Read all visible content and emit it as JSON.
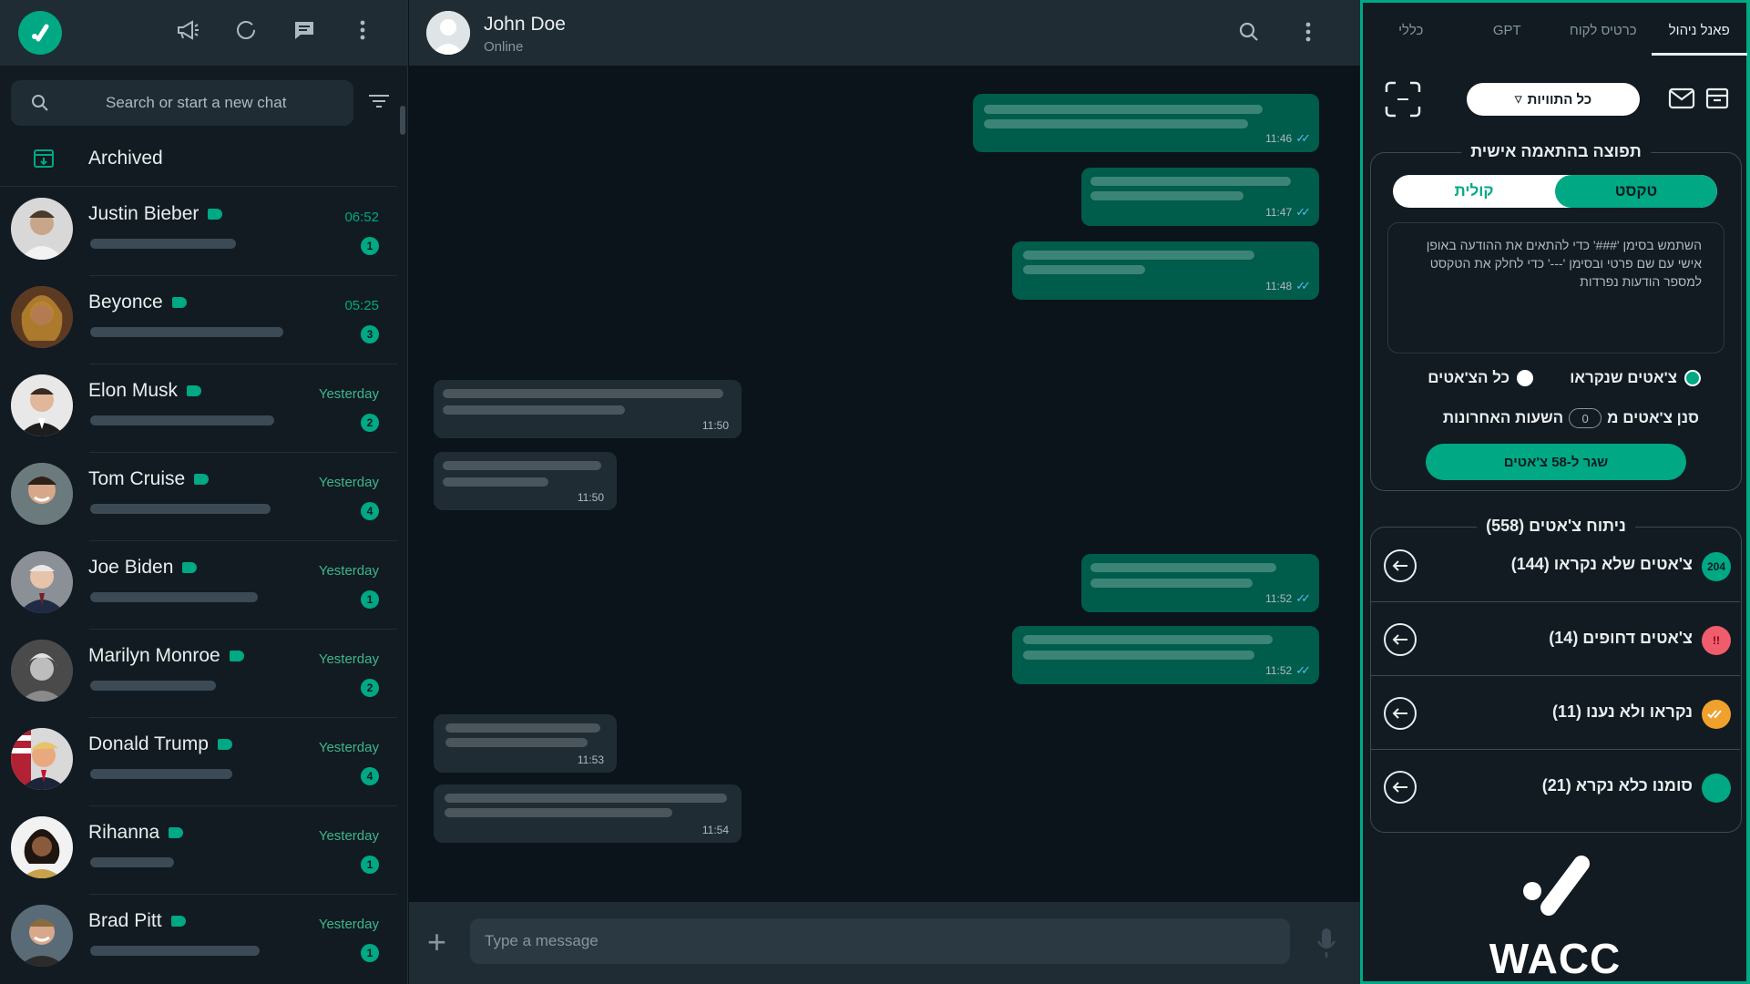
{
  "colors": {
    "accent": "#00a884",
    "panel_bg": "#111b21",
    "bubble_out": "#005c4b",
    "bubble_in": "#202c33",
    "red": "#f15c6d",
    "orange": "#f0a02c"
  },
  "sidebar": {
    "search_placeholder": "Search or start a new chat",
    "archived_label": "Archived",
    "header_icons": [
      "megaphone-icon",
      "status-ring-icon",
      "chat-bubble-icon",
      "menu-dots-icon"
    ],
    "chats": [
      {
        "name": "Justin Bieber",
        "time": "06:52",
        "unread": "1"
      },
      {
        "name": "Beyonce",
        "time": "05:25",
        "unread": "3"
      },
      {
        "name": "Elon Musk",
        "time": "Yesterday",
        "unread": "2"
      },
      {
        "name": "Tom Cruise",
        "time": "Yesterday",
        "unread": "4"
      },
      {
        "name": "Joe Biden",
        "time": "Yesterday",
        "unread": "1"
      },
      {
        "name": "Marilyn Monroe",
        "time": "Yesterday",
        "unread": "2"
      },
      {
        "name": "Donald Trump",
        "time": "Yesterday",
        "unread": "4"
      },
      {
        "name": "Rihanna",
        "time": "Yesterday",
        "unread": "1"
      },
      {
        "name": "Brad Pitt",
        "time": "Yesterday",
        "unread": "1"
      }
    ]
  },
  "conversation": {
    "contact_name": "John Doe",
    "status": "Online",
    "composer_placeholder": "Type a message",
    "messages": [
      {
        "dir": "out",
        "time": "11:46"
      },
      {
        "dir": "out",
        "time": "11:47"
      },
      {
        "dir": "out",
        "time": "11:48"
      },
      {
        "dir": "in",
        "time": "11:50"
      },
      {
        "dir": "in",
        "time": "11:50"
      },
      {
        "dir": "out",
        "time": "11:52"
      },
      {
        "dir": "out",
        "time": "11:52"
      },
      {
        "dir": "in",
        "time": "11:53"
      },
      {
        "dir": "in",
        "time": "11:54"
      }
    ]
  },
  "panel": {
    "tabs": [
      "פאנל ניהול",
      "כרטיס לקוח",
      "GPT",
      "כללי"
    ],
    "labels_button": "כל התוויות",
    "personal_response": {
      "title": "תפוצה בהתאמה אישית",
      "toggle_text": "טקסט",
      "toggle_voice": "קולית",
      "hint": "השתמש בסימן '###' כדי להתאים את ההודעה באופן אישי עם שם פרטי ובסימן '---' כדי לחלק את הטקסט למספר הודעות נפרדות",
      "radio_read": "צ'אטים שנקראו",
      "radio_all": "כל הצ'אטים",
      "filter_prefix": "סנן צ'אטים מ",
      "filter_hours": "0",
      "filter_suffix": "השעות האחרונות",
      "send_label": "שגר ל-58 צ'אטים"
    },
    "analysis": {
      "title": "ניתוח צ'אטים (558)",
      "rows": [
        {
          "label": "צ'אטים שלא נקראו (144)",
          "badge": "204",
          "icon": "unread-count-icon"
        },
        {
          "label": "צ'אטים דחופים (14)",
          "badge": "!!",
          "icon": "urgent-icon"
        },
        {
          "label": "נקראו ולא נענו (11)",
          "badge": "",
          "icon": "double-check-icon"
        },
        {
          "label": "סומנו כלא נקרא (21)",
          "badge": "",
          "icon": "marked-unread-icon"
        }
      ]
    },
    "brand": "WACC"
  }
}
